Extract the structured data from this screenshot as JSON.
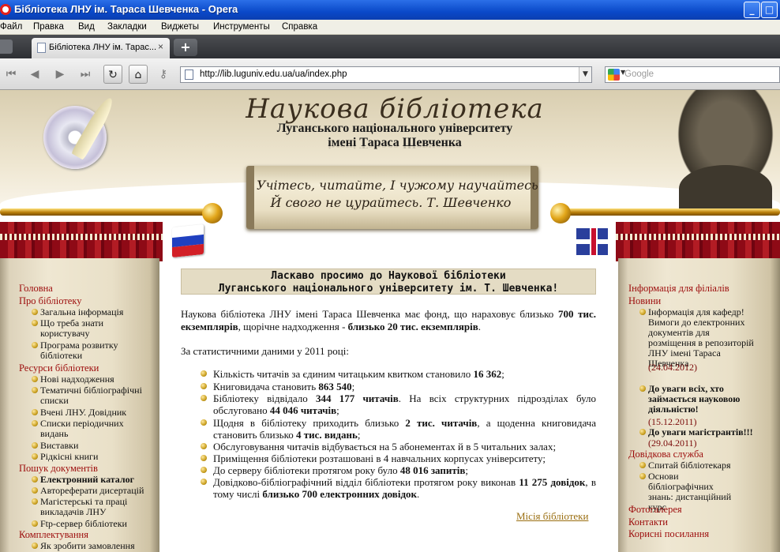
{
  "window": {
    "title": "Бібліотека ЛНУ ім. Тараса Шевченка - Opera",
    "minimize_glyph": "_",
    "maximize_glyph": "□"
  },
  "menu": [
    "Файл",
    "Правка",
    "Вид",
    "Закладки",
    "Виджеты",
    "Инструменты",
    "Справка"
  ],
  "tabs": {
    "active_label": "Бібліотека ЛНУ ім. Тарас...",
    "close_glyph": "×",
    "new_tab_glyph": "+"
  },
  "toolbar": {
    "url": "http://lib.luguniv.edu.ua/ua/index.php",
    "search_placeholder": "Google",
    "back_glyph": "◀",
    "forward_glyph": "▶",
    "rewind_glyph": "⏮",
    "fastforward_glyph": "⏭",
    "reload_glyph": "↻",
    "home_glyph": "⌂",
    "key_glyph": "⚷",
    "dropdown_glyph": "▼"
  },
  "header": {
    "title": "Наукова бібліотека",
    "subtitle_line1": "Луганського національного університету",
    "subtitle_line2": "імені Тараса Шевченка",
    "quote_line1": "Учітесь, читайте, І чужому научайтесь",
    "quote_line2": "Й свого не цурайтесь. Т. Шевченко"
  },
  "left_nav": {
    "home": "Головна",
    "about": "Про бібліотеку",
    "about_items": [
      "Загальна інформація",
      "Що треба знати користувачу",
      "Програма розвитку бібліотеки"
    ],
    "resources": "Ресурси бібліотеки",
    "resource_items": [
      "Нові надходження",
      "Тематичні бібліографічні списки",
      "Вчені ЛНУ. Довідник",
      "Списки періодичних видань",
      "Виставки",
      "Рідкісні книги"
    ],
    "search": "Пошук документів",
    "search_items": [
      "Електронний каталог",
      "Автореферати дисертацій",
      "Магістерські та праці викладачів ЛНУ",
      "Ftp-сервер бібліотеки"
    ],
    "acquisition": "Комплектування",
    "acquisition_items": [
      "Як зробити замовлення"
    ]
  },
  "right_nav": {
    "branches": "Інформація для філіалів",
    "news": "Новини",
    "news_items": [
      {
        "text": "Інформація для кафедр! Вимоги до електронних документів для розміщення в репозиторій ЛНУ імені Тараса Шевченка",
        "date": "(24.04.2012)"
      },
      {
        "text": "До уваги всіх, хто займається науковою діяльністю!",
        "date": "(15.12.2011)"
      },
      {
        "text": "До уваги магістрантів!!!",
        "date": "(29.04.2011)"
      }
    ],
    "reference": "Довідкова служба",
    "reference_items": [
      "Спитай бібліотекаря",
      "Основи бібліографічних знань: дистанційний курс"
    ],
    "gallery": "Фотогалерея",
    "contacts": "Контакти",
    "links": "Корисні посилання"
  },
  "content": {
    "welcome_line1": "Ласкаво просимо до Наукової бібліотеки",
    "welcome_line2": "Луганського національного університету ім. Т. Шевченка!",
    "intro_a": "Наукова бібліотека ЛНУ імені Тараса Шевченка має фонд, що нараховує близько ",
    "intro_b": "700 тис. екземплярів",
    "intro_c": ", щорічне надходження - ",
    "intro_d": "близько 20 тис. екземплярів",
    "intro_e": ".",
    "stats_intro": "За статистичними даними у 2011 році:",
    "stats": [
      {
        "a": "Кількість читачів за єдиним читацьким квитком становило ",
        "b": "16 362",
        "c": ";"
      },
      {
        "a": "Книговидача становить ",
        "b": "863 540",
        "c": ";"
      },
      {
        "a": "Бібліотеку відвідало ",
        "b": "344 177 читачів",
        "c": ". На всіх структурних підрозділах було обслуговано ",
        "d": "44 046 читачів",
        "e": ";"
      },
      {
        "a": "Щодня в бібліотеку приходить близько ",
        "b": "2 тис. читачів",
        "c": ", а щоденна книговидача становить близько ",
        "d": "4 тис. видань",
        "e": ";"
      },
      {
        "a": "Обслуговування читачів відбувається на 5 абонементах й в 5 читальних залах;"
      },
      {
        "a": "Приміщення бібліотеки розташовані в 4 навчальних корпусах університету;"
      },
      {
        "a": "До серверу бібліотеки протягом року було ",
        "b": "48 016 запитів",
        "c": ";"
      },
      {
        "a": "Довідково-бібліографічний відділ бібліотеки протягом року виконав ",
        "b": "11 275 довідок",
        "c": ", в тому числі ",
        "d": "близько 700 електронних довідок",
        "e": "."
      }
    ],
    "mission_link": "Місія бібліотеки"
  },
  "colors": {
    "menu_heading": "#9c0b0b",
    "link_gold": "#9a6e10",
    "titlebar": "#0a49c9"
  }
}
